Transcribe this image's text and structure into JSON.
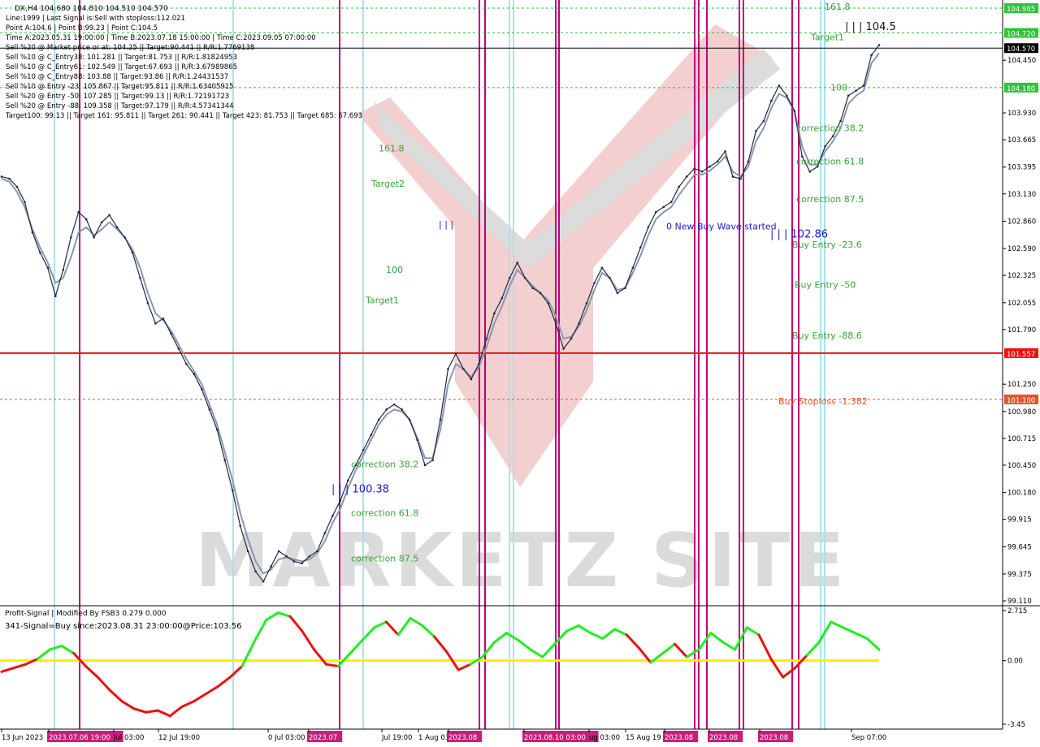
{
  "header": {
    "symbol_line": "DX,H4  104.680 104.810 104.510 104.570",
    "info_lines": [
      "Line:1999 | Last Signal is:Sell with stoploss:112.021",
      "Point A:104.6 | Point B:99.23 | Point C:104.5",
      "Time A:2023.05.31 19:00:00 | Time B:2023.07.18 15:00:00 | Time C:2023.09.05 07:00:00",
      "Sell %20 @ Market price or at: 104.25 || Target:90.441 || R/R:1.7769138",
      "Sell %10 @ C_Entry38: 101.281 || Target:81.753 || R/R:1.81824953",
      "Sell %10 @ C_Entry61: 102.549 || Target:67.693 || R/R:3.67989865",
      "Sell %10 @ C_Entry88: 103.88 || Target:93.86 || R/R:1.24431537",
      "Sell %10 @ Entry -23: 105.867 || Target:95.811 || R/R:1.63405915",
      "Sell %20 @ Entry -50: 107.285 || Target:99.13 || R/R:1.72191723",
      "Sell %20 @ Entry -88: 109.358 || Target:97.179 || R/R:4.57341344",
      "Target100: 99.13 || Target 161: 95.811 || Target 261: 90.441 || Target 423: 81.753 || Target 685: 67.693"
    ]
  },
  "colors": {
    "background": "#ffffff",
    "bull_line": "#1d2a3a",
    "signal_line": "#8a96b0",
    "vline_magenta": "#c0007a",
    "vline_cyan": "#a8e4ec",
    "level_green": "#2fc43a",
    "stop_red": "#ee1111",
    "osc_up": "#22ee22",
    "osc_down": "#ee1111",
    "zero_line": "#ffee00",
    "label_green": "#3aa33a",
    "label_blue": "#1a1acc",
    "label_orange": "#e85522",
    "watermark": "#d8d8d8"
  },
  "chart_data": [
    {
      "type": "line",
      "ylim": [
        99.11,
        104.965
      ],
      "y_ticks": [
        "104.965",
        "104.720",
        "104.570",
        "104.450",
        "104.180",
        "103.930",
        "103.665",
        "103.395",
        "103.130",
        "102.860",
        "102.590",
        "102.325",
        "102.055",
        "101.790",
        "101.557",
        "101.250",
        "101.100",
        "100.980",
        "100.715",
        "100.450",
        "100.180",
        "99.915",
        "99.645",
        "99.375",
        "99.110"
      ],
      "x_labels": [
        "13 Jun 2023",
        "2023.07.06 19:00",
        "Jul 03:00",
        "12 Jul 19:00",
        "0 Jul 03:00",
        "2023.07",
        "Jul 19:00",
        "1 Aug 03",
        "2023.08",
        "2023.08.10 03:00",
        "ug 03:00",
        "15 Aug 19",
        "2023.08",
        "2023.08",
        "2023.08",
        "Sep 07:00"
      ],
      "x_label_tags": [
        false,
        true,
        false,
        false,
        false,
        true,
        false,
        false,
        true,
        true,
        false,
        false,
        true,
        true,
        true,
        false
      ],
      "price_series": [
        103.3,
        103.28,
        103.2,
        103.05,
        102.75,
        102.55,
        102.4,
        102.12,
        102.38,
        102.7,
        102.95,
        102.88,
        102.7,
        102.85,
        102.92,
        102.8,
        102.7,
        102.55,
        102.3,
        102.05,
        101.85,
        101.9,
        101.75,
        101.6,
        101.45,
        101.35,
        101.2,
        101.0,
        100.8,
        100.5,
        100.2,
        99.85,
        99.6,
        99.4,
        99.3,
        99.45,
        99.6,
        99.55,
        99.5,
        99.48,
        99.55,
        99.6,
        99.78,
        99.95,
        100.1,
        100.3,
        100.45,
        100.6,
        100.75,
        100.9,
        101.0,
        101.05,
        101.0,
        100.9,
        100.7,
        100.45,
        100.5,
        100.9,
        101.4,
        101.55,
        101.4,
        101.3,
        101.45,
        101.7,
        101.95,
        102.1,
        102.3,
        102.45,
        102.3,
        102.2,
        102.15,
        102.05,
        101.85,
        101.6,
        101.7,
        101.85,
        102.05,
        102.25,
        102.4,
        102.3,
        102.15,
        102.2,
        102.4,
        102.6,
        102.8,
        102.95,
        103.0,
        103.05,
        103.2,
        103.3,
        103.38,
        103.35,
        103.4,
        103.45,
        103.55,
        103.3,
        103.28,
        103.45,
        103.75,
        103.85,
        104.05,
        104.2,
        104.1,
        103.95,
        103.5,
        103.35,
        103.4,
        103.6,
        103.7,
        103.85,
        104.1,
        104.15,
        104.2,
        104.5,
        104.6
      ],
      "signal_series": [
        103.28,
        103.25,
        103.15,
        103.0,
        102.78,
        102.6,
        102.45,
        102.25,
        102.3,
        102.5,
        102.75,
        102.8,
        102.72,
        102.78,
        102.85,
        102.78,
        102.7,
        102.58,
        102.4,
        102.15,
        101.95,
        101.88,
        101.78,
        101.64,
        101.5,
        101.38,
        101.25,
        101.05,
        100.85,
        100.58,
        100.3,
        99.98,
        99.72,
        99.5,
        99.38,
        99.42,
        99.52,
        99.54,
        99.52,
        99.5,
        99.52,
        99.58,
        99.7,
        99.88,
        100.02,
        100.22,
        100.4,
        100.55,
        100.7,
        100.85,
        100.95,
        101.0,
        100.98,
        100.9,
        100.72,
        100.52,
        100.52,
        100.8,
        101.25,
        101.45,
        101.4,
        101.32,
        101.42,
        101.62,
        101.85,
        102.02,
        102.22,
        102.38,
        102.3,
        102.22,
        102.15,
        102.08,
        101.92,
        101.7,
        101.72,
        101.82,
        101.98,
        102.18,
        102.35,
        102.3,
        102.18,
        102.2,
        102.35,
        102.52,
        102.72,
        102.88,
        102.95,
        103.0,
        103.12,
        103.22,
        103.32,
        103.32,
        103.36,
        103.42,
        103.5,
        103.35,
        103.3,
        103.4,
        103.65,
        103.78,
        103.98,
        104.12,
        104.08,
        103.95,
        103.6,
        103.42,
        103.42,
        103.55,
        103.65,
        103.78,
        104.02,
        104.1,
        104.15,
        104.42,
        104.52
      ],
      "horizontal_levels": [
        {
          "label": "104.965",
          "value": 104.965,
          "style": "dashed-green"
        },
        {
          "label": "104.720",
          "value": 104.72,
          "style": "dashed-green"
        },
        {
          "label": "104.570",
          "value": 104.57,
          "style": "solid-black"
        },
        {
          "label": "104.180",
          "value": 104.18,
          "style": "dashed-green"
        },
        {
          "label": "101.557",
          "value": 101.557,
          "style": "solid-red"
        },
        {
          "label": "101.100",
          "value": 101.1,
          "style": "dashed-red"
        }
      ],
      "annotations": [
        {
          "text": "161.8",
          "value": 104.95,
          "color": "label_green"
        },
        {
          "text": "| | | 104.5",
          "value": 104.75,
          "color": "label_dark"
        },
        {
          "text": "Target1",
          "value": 104.65,
          "color": "label_green"
        },
        {
          "text": "100",
          "value": 104.15,
          "color": "label_green"
        },
        {
          "text": "correction 38.2",
          "value": 103.75,
          "color": "label_green"
        },
        {
          "text": "correction 61.8",
          "value": 103.42,
          "color": "label_green"
        },
        {
          "text": "correction 87.5",
          "value": 103.05,
          "color": "label_green"
        },
        {
          "text": "0 New Buy Wave started",
          "value": 102.78,
          "color": "label_blue"
        },
        {
          "text": "| | | 102.86",
          "value": 102.7,
          "color": "label_blue"
        },
        {
          "text": "Buy Entry -23.6",
          "value": 102.6,
          "color": "label_green"
        },
        {
          "text": "Buy Entry -50",
          "value": 102.2,
          "color": "label_green"
        },
        {
          "text": "Buy Entry -88.6",
          "value": 101.7,
          "color": "label_green"
        },
        {
          "text": "Buy Stoploss -1.382",
          "value": 101.05,
          "color": "label_orange"
        },
        {
          "text": "161.8",
          "value": 103.55,
          "color": "label_green"
        },
        {
          "text": "Target2",
          "value": 103.2,
          "color": "label_green"
        },
        {
          "text": "| | |",
          "value": 102.8,
          "color": "label_blue"
        },
        {
          "text": "100",
          "value": 102.35,
          "color": "label_green"
        },
        {
          "text": "Target1",
          "value": 102.05,
          "color": "label_green"
        },
        {
          "text": "correction 38.2",
          "value": 100.43,
          "color": "label_green"
        },
        {
          "text": "| | | 100.38",
          "value": 100.18,
          "color": "label_blue"
        },
        {
          "text": "correction 61.8",
          "value": 99.95,
          "color": "label_green"
        },
        {
          "text": "correction 87.5",
          "value": 99.5,
          "color": "label_green"
        }
      ]
    },
    {
      "type": "line",
      "title": "Profit-Signal | Modified By FSB3 0.279 0.000",
      "subtitle": "341-Signal=Buy since:2023.08.31 23:00:00@Price:103.56",
      "ylim": [
        -3.45,
        2.715
      ],
      "y_ticks": [
        "2.715",
        "0.00",
        "-3.45"
      ],
      "values": [
        -0.6,
        -0.4,
        -0.2,
        0.1,
        0.6,
        0.8,
        0.4,
        -0.3,
        -0.9,
        -1.6,
        -2.2,
        -2.6,
        -2.8,
        -2.7,
        -3.0,
        -2.5,
        -2.2,
        -1.8,
        -1.4,
        -0.9,
        -0.3,
        1.0,
        2.2,
        2.6,
        2.4,
        1.6,
        0.6,
        -0.2,
        -0.3,
        0.4,
        1.1,
        1.8,
        2.1,
        1.4,
        2.3,
        1.9,
        1.3,
        0.5,
        -0.5,
        -0.2,
        0.2,
        1.0,
        1.5,
        1.1,
        0.6,
        0.2,
        0.9,
        1.6,
        1.9,
        1.5,
        1.2,
        1.7,
        1.4,
        0.7,
        -0.1,
        0.4,
        0.9,
        0.2,
        0.6,
        1.5,
        1.0,
        0.6,
        1.8,
        1.4,
        0.1,
        -0.9,
        -0.4,
        0.3,
        1.0,
        2.1,
        1.8,
        1.5,
        1.2,
        0.6
      ]
    }
  ],
  "watermark_text": "MARKETZ SITE"
}
